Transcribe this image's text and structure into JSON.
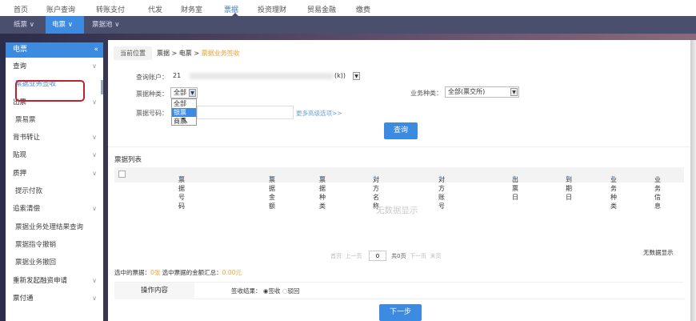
{
  "topnav": {
    "items": [
      "首页",
      "账户查询",
      "转账支付",
      "代发",
      "财务室",
      "票据",
      "投资理财",
      "贸易金融",
      "缴费"
    ],
    "active": "票据"
  },
  "subnav": {
    "items": [
      "纸票 ∨",
      "电票 ∨",
      "票据池 ∨"
    ],
    "active": "电票 ∨"
  },
  "sidebar": {
    "title": "电票",
    "collapse_icon": "«",
    "items": [
      {
        "label": "查询",
        "chevron": true
      },
      {
        "label": "票据业务签收",
        "sub": true,
        "selected": true
      },
      {
        "label": "出票",
        "chevron": true
      },
      {
        "label": "票易票",
        "sub": true
      },
      {
        "label": "背书转让",
        "chevron": true
      },
      {
        "label": "贴现",
        "chevron": true
      },
      {
        "label": "质押",
        "chevron": true
      },
      {
        "label": "提示付款",
        "sub": true
      },
      {
        "label": "追索清偿",
        "chevron": true
      },
      {
        "label": "票据业务处理结果查询",
        "sub": true
      },
      {
        "label": "票据指令撤销",
        "sub": true
      },
      {
        "label": "票据业务撤回",
        "sub": true
      },
      {
        "label": "重新发起融资申请",
        "chevron": true
      },
      {
        "label": "票付通",
        "chevron": true
      }
    ]
  },
  "breadcrumb": {
    "here": "当前位置",
    "path": "票据 > 电票 > ",
    "current": "票据业务签收"
  },
  "form": {
    "account_label": "查询账户：",
    "account_value": "21",
    "account_suffix": "(k))",
    "type_label": "票据种类：",
    "type_value": "全部",
    "type_options": [
      "全部",
      "银票",
      "商票"
    ],
    "type_highlight": "银票",
    "biz_label": "业务种类：",
    "biz_value": "全部(票交所)",
    "no_label": "票据号码：",
    "no_value": "",
    "more_link": "更多高级选项>>",
    "query_button": "查询"
  },
  "list": {
    "title": "票据列表",
    "columns": [
      "票据号码",
      "票据金额",
      "票据种类",
      "对方名称",
      "对方账号",
      "出票日",
      "到期日",
      "业务种类",
      "业务信息"
    ],
    "empty": "无数据显示"
  },
  "pager": {
    "first": "首页",
    "prev": "上一页",
    "page": "0",
    "total": "共0页",
    "next": "下一页",
    "last": "末页",
    "status": "无数据显示"
  },
  "summary": {
    "selected_label": "选中的票据：",
    "selected_count": "0张",
    "amount_label": "选中票据的金额汇总：",
    "amount": "0.00元"
  },
  "operation": {
    "title": "操作内容",
    "result_label": "签收结果：",
    "options": [
      "签收",
      "驳回"
    ],
    "selected": "签收"
  },
  "next_button": "下一步"
}
